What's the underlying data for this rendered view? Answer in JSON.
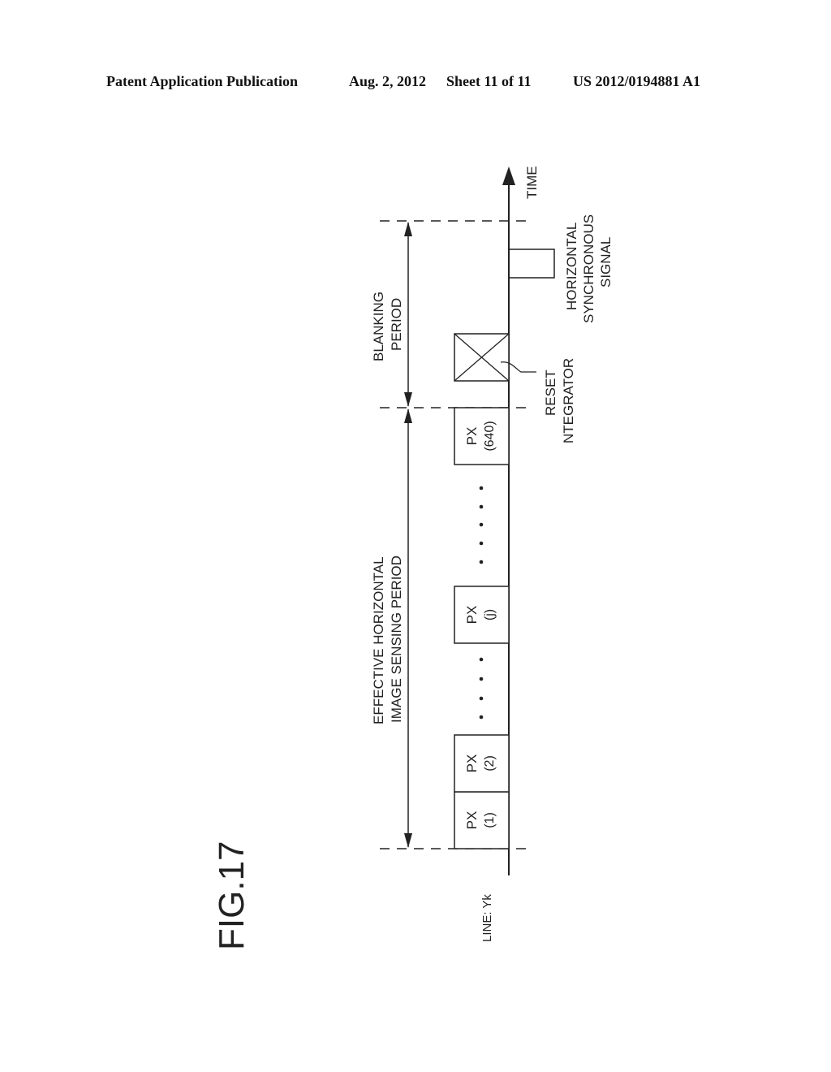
{
  "header": {
    "publication_type": "Patent Application Publication",
    "date": "Aug. 2, 2012",
    "sheet": "Sheet 11 of 11",
    "patent_number": "US 2012/0194881 A1"
  },
  "figure": {
    "label": "FIG.17",
    "line_label": "LINE: Yk",
    "time_label": "TIME",
    "periods": {
      "effective": [
        "EFFECTIVE HORIZONTAL",
        "IMAGE SENSING PERIOD"
      ],
      "blanking": [
        "BLANKING",
        "PERIOD"
      ]
    },
    "pixels": [
      {
        "name": "PX",
        "index": "(1)"
      },
      {
        "name": "PX",
        "index": "(2)"
      },
      {
        "name": "PX",
        "index": "(j)"
      },
      {
        "name": "PX",
        "index": "(640)"
      }
    ],
    "reset_integrator": [
      "RESET",
      "NTEGRATOR"
    ],
    "sync_signal": [
      "HORIZONTAL",
      "SYNCHRONOUS",
      "SIGNAL"
    ],
    "colors": {
      "ink": "#222222",
      "background": "#ffffff"
    }
  }
}
